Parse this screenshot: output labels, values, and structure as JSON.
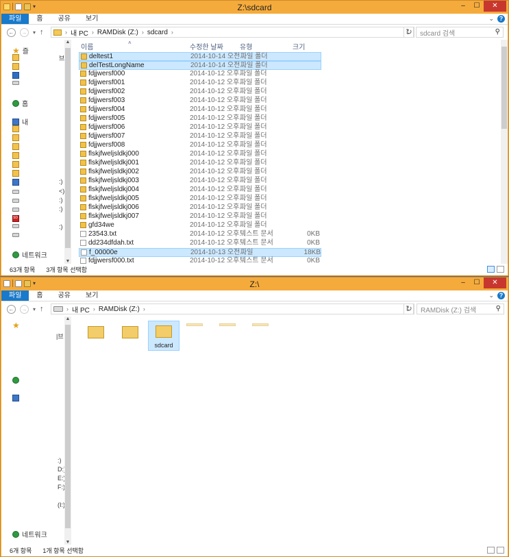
{
  "top": {
    "title": "Z:\\sdcard",
    "ribbon_tabs": [
      "파일",
      "홈",
      "공유",
      "보기"
    ],
    "breadcrumb": [
      "내 PC",
      "RAMDisk (Z:)",
      "sdcard"
    ],
    "search_placeholder": "sdcard 검색",
    "columns": [
      "이름",
      "수정한 날짜",
      "유형",
      "크기"
    ],
    "nav_pane": {
      "network_label": "네트워크",
      "trail": [
        "브",
        ":)",
        "<)",
        ":)",
        ":)",
        ":)"
      ]
    },
    "files": [
      {
        "name": "deltest1",
        "date": "2014-10-14 오전...",
        "type": "파일 폴더",
        "size": "",
        "kind": "folder",
        "selected": true
      },
      {
        "name": "delTestLongName",
        "date": "2014-10-14 오전...",
        "type": "파일 폴더",
        "size": "",
        "kind": "folder",
        "selected": true
      },
      {
        "name": "fdjjwersf000",
        "date": "2014-10-12 오후...",
        "type": "파일 폴더",
        "size": "",
        "kind": "folder",
        "selected": false
      },
      {
        "name": "fdjjwersf001",
        "date": "2014-10-12 오후...",
        "type": "파일 폴더",
        "size": "",
        "kind": "folder",
        "selected": false
      },
      {
        "name": "fdjjwersf002",
        "date": "2014-10-12 오후...",
        "type": "파일 폴더",
        "size": "",
        "kind": "folder",
        "selected": false
      },
      {
        "name": "fdjjwersf003",
        "date": "2014-10-12 오후...",
        "type": "파일 폴더",
        "size": "",
        "kind": "folder",
        "selected": false
      },
      {
        "name": "fdjjwersf004",
        "date": "2014-10-12 오후...",
        "type": "파일 폴더",
        "size": "",
        "kind": "folder",
        "selected": false
      },
      {
        "name": "fdjjwersf005",
        "date": "2014-10-12 오후...",
        "type": "파일 폴더",
        "size": "",
        "kind": "folder",
        "selected": false
      },
      {
        "name": "fdjjwersf006",
        "date": "2014-10-12 오후...",
        "type": "파일 폴더",
        "size": "",
        "kind": "folder",
        "selected": false
      },
      {
        "name": "fdjjwersf007",
        "date": "2014-10-12 오후...",
        "type": "파일 폴더",
        "size": "",
        "kind": "folder",
        "selected": false
      },
      {
        "name": "fdjjwersf008",
        "date": "2014-10-12 오후...",
        "type": "파일 폴더",
        "size": "",
        "kind": "folder",
        "selected": false
      },
      {
        "name": "flskjfweljsldkj000",
        "date": "2014-10-12 오후...",
        "type": "파일 폴더",
        "size": "",
        "kind": "folder",
        "selected": false
      },
      {
        "name": "flskjfweljsldkj001",
        "date": "2014-10-12 오후...",
        "type": "파일 폴더",
        "size": "",
        "kind": "folder",
        "selected": false
      },
      {
        "name": "flskjfweljsldkj002",
        "date": "2014-10-12 오후...",
        "type": "파일 폴더",
        "size": "",
        "kind": "folder",
        "selected": false
      },
      {
        "name": "flskjfweljsldkj003",
        "date": "2014-10-12 오후...",
        "type": "파일 폴더",
        "size": "",
        "kind": "folder",
        "selected": false
      },
      {
        "name": "flskjfweljsldkj004",
        "date": "2014-10-12 오후...",
        "type": "파일 폴더",
        "size": "",
        "kind": "folder",
        "selected": false
      },
      {
        "name": "flskjfweljsldkj005",
        "date": "2014-10-12 오후...",
        "type": "파일 폴더",
        "size": "",
        "kind": "folder",
        "selected": false
      },
      {
        "name": "flskjfweljsldkj006",
        "date": "2014-10-12 오후...",
        "type": "파일 폴더",
        "size": "",
        "kind": "folder",
        "selected": false
      },
      {
        "name": "flskjfweljsldkj007",
        "date": "2014-10-12 오후...",
        "type": "파일 폴더",
        "size": "",
        "kind": "folder",
        "selected": false
      },
      {
        "name": "gfd34we",
        "date": "2014-10-12 오후...",
        "type": "파일 폴더",
        "size": "",
        "kind": "folder",
        "selected": false
      },
      {
        "name": "23543.txt",
        "date": "2014-10-12 오후...",
        "type": "텍스트 문서",
        "size": "0KB",
        "kind": "text",
        "selected": false
      },
      {
        "name": "dd234dfdah.txt",
        "date": "2014-10-12 오후...",
        "type": "텍스트 문서",
        "size": "0KB",
        "kind": "text",
        "selected": false
      },
      {
        "name": "f_00000e",
        "date": "2014-10-13 오전...",
        "type": "파일",
        "size": "18KB",
        "kind": "file",
        "selected": true
      },
      {
        "name": "fdjjwersf000.txt",
        "date": "2014-10-12 오후...",
        "type": "텍스트 문서",
        "size": "0KB",
        "kind": "text",
        "selected": false
      }
    ],
    "status": {
      "count": "63개 항목",
      "selected": "3개 항목 선택함"
    }
  },
  "bottom": {
    "title": "Z:\\",
    "ribbon_tabs": [
      "파일",
      "홈",
      "공유",
      "보기"
    ],
    "breadcrumb": [
      "내 PC",
      "RAMDisk (Z:)"
    ],
    "search_placeholder": "RAMDisk (Z:) 검색",
    "nav_pane": {
      "network_label": "네트워크",
      "trail": [
        "|브",
        ":)",
        "D:)",
        "E:)",
        "F:)",
        "(I:)"
      ]
    },
    "tiles": [
      {
        "label": "",
        "selected": false,
        "faint": false
      },
      {
        "label": "",
        "selected": false,
        "faint": false
      },
      {
        "label": "sdcard",
        "selected": true,
        "faint": false
      },
      {
        "label": "",
        "selected": false,
        "faint": true
      },
      {
        "label": "",
        "selected": false,
        "faint": true
      },
      {
        "label": "",
        "selected": false,
        "faint": true
      }
    ],
    "status": {
      "count": "6개 항목",
      "selected": "1개 항목 선택함"
    }
  }
}
